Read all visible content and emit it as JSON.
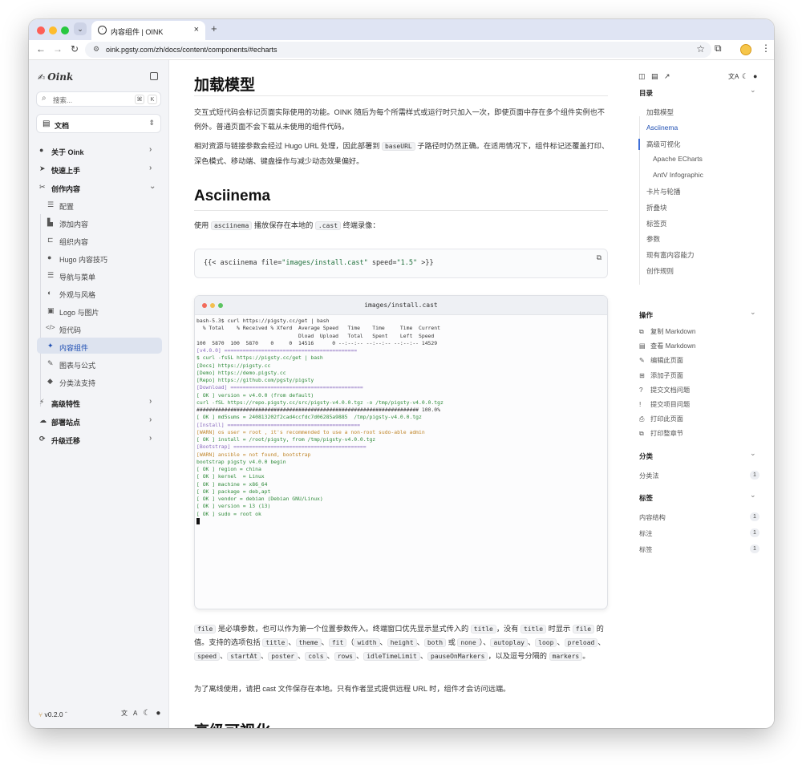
{
  "browser": {
    "tab_title": "内容组件 | OINK",
    "tab_close": "×",
    "new_tab": "+",
    "url": "oink.pgsty.com/zh/docs/content/components/#echarts",
    "nav": {
      "back": "←",
      "forward": "→",
      "reload": "↻"
    }
  },
  "sidebar": {
    "logo_text": "Oink",
    "search_placeholder": "搜索...",
    "search_kbd": [
      "⌘",
      "K"
    ],
    "doc_selector": "文档",
    "items": [
      {
        "label": "关于 Oink",
        "icon": "●"
      },
      {
        "label": "快速上手",
        "icon": "➤"
      },
      {
        "label": "创作内容",
        "icon": "✂"
      }
    ],
    "sub_items": [
      {
        "label": "配置",
        "icon": "☰"
      },
      {
        "label": "添加内容",
        "icon": "▙"
      },
      {
        "label": "组织内容",
        "icon": "⊏"
      },
      {
        "label": "Hugo 内容技巧",
        "icon": "●"
      },
      {
        "label": "导航与菜单",
        "icon": "☰"
      },
      {
        "label": "外观与风格",
        "icon": "◐"
      },
      {
        "label": "Logo 与图片",
        "icon": "▣"
      },
      {
        "label": "短代码",
        "icon": "</>"
      },
      {
        "label": "内容组件",
        "icon": "✦"
      },
      {
        "label": "图表与公式",
        "icon": "✎"
      },
      {
        "label": "分类法支持",
        "icon": "◆"
      }
    ],
    "bottom_items": [
      {
        "label": "高级特性",
        "icon": "⚡"
      },
      {
        "label": "部署站点",
        "icon": "☁"
      },
      {
        "label": "升级迁移",
        "icon": "⟳"
      }
    ],
    "version": "v0.2.0",
    "footer_icons": [
      "translate-icon",
      "moon-icon",
      "github-icon"
    ]
  },
  "main": {
    "h1": "加载模型",
    "p1": "交互式短代码会标记页面实际使用的功能。OINK 随后为每个所需样式或运行时只加入一次，即使页面中存在多个组件实例也不例外。普通页面不会下载从未使用的组件代码。",
    "p2_a": "相对资源与链接参数会经过 Hugo URL 处理，因此部署到",
    "p2_code": "baseURL",
    "p2_b": "子路径时仍然正确。在适用情况下，组件标记还覆盖打印、深色模式、移动端、键盘操作与减少动态效果偏好。",
    "h2": "Asciinema",
    "p3_a": "使用",
    "p3_code1": "asciinema",
    "p3_b": "播放保存在本地的",
    "p3_code2": ".cast",
    "p3_c": "终端录像：",
    "code_pre": "{{< asciinema file=",
    "code_str1": "\"images/install.cast\"",
    "code_mid": " speed=",
    "code_str2": "\"1.5\"",
    "code_post": " >}}",
    "term_title": "images/install.cast",
    "p4_file": "file",
    "p4_a": "是必填参数，也可以作为第一个位置参数传入。终端窗口优先显示显式传入的",
    "p4_title1": "title",
    "p4_b": "，没有",
    "p4_title2": "title",
    "p4_c": "时显示",
    "p4_file2": "file",
    "p4_d": "的值。支持的选项包括",
    "opts1": [
      "title",
      "theme",
      "fit"
    ],
    "opts_paren": [
      "width",
      "height",
      "both"
    ],
    "opts_or": "或",
    "opt_none": "none",
    "opts2": [
      "autoplay",
      "loop",
      "preload",
      "speed",
      "startAt",
      "poster",
      "cols",
      "rows",
      "idleTimeLimit",
      "pauseOnMarkers"
    ],
    "p4_e": "，以及逗号分隔的",
    "p4_markers": "markers",
    "p4_f": "。",
    "p5": "为了离线使用，请把 cast 文件保存在本地。只有作者显式提供远程 URL 时，组件才会访问远端。",
    "h2b": "高级可视化"
  },
  "terminal_lines": [
    {
      "t": "bash-5.3$ curl https://pigsty.cc/get | bash",
      "c": "#333"
    },
    {
      "t": "  % Total    % Received % Xferd  Average Speed   Time    Time     Time  Current",
      "c": "#333"
    },
    {
      "t": "                                 Dload  Upload   Total   Spent    Left  Speed",
      "c": "#333"
    },
    {
      "t": "100  5870  100  5870    0     0  14516      0 --:--:-- --:--:-- --:--:-- 14529",
      "c": "#333"
    },
    {
      "t": "[v4.0.0] ===========================================",
      "c": "#8a6bbf"
    },
    {
      "t": "$ curl -fsSL https://pigsty.cc/get | bash",
      "c": "#2f8a3a"
    },
    {
      "t": "[Docs] https://pigsty.cc",
      "c": "#2f8a3a"
    },
    {
      "t": "[Demo] https://demo.pigsty.cc",
      "c": "#2f8a3a"
    },
    {
      "t": "[Repo] https://github.com/pgsty/pigsty",
      "c": "#2f8a3a"
    },
    {
      "t": "[Download] ===========================================",
      "c": "#8a6bbf"
    },
    {
      "t": "[ OK ] version = v4.0.0 (from default)",
      "c": "#2f8a3a"
    },
    {
      "t": "curl -fSL https://repo.pigsty.cc/src/pigsty-v4.0.0.tgz -o /tmp/pigsty-v4.0.0.tgz",
      "c": "#2f8a3a"
    },
    {
      "t": "######################################################################## 100.0%",
      "c": "#333"
    },
    {
      "t": "[ OK ] md5sums = 240813202f2cad4ccfdc7d06285a9885  /tmp/pigsty-v4.0.0.tgz",
      "c": "#2f8a3a"
    },
    {
      "t": "[Install] ===========================================",
      "c": "#8a6bbf"
    },
    {
      "t": "[WARN] os user = root , it's recommended to use a non-root sudo-able admin",
      "c": "#c0862a"
    },
    {
      "t": "[ OK ] install = /root/pigsty, from /tmp/pigsty-v4.0.0.tgz",
      "c": "#2f8a3a"
    },
    {
      "t": "[Bootstrap] ===========================================",
      "c": "#8a6bbf"
    },
    {
      "t": "[WARN] ansible = not found, bootstrap",
      "c": "#c0862a"
    },
    {
      "t": "bootstrap pigsty v4.0.0 begin",
      "c": "#2f8a3a"
    },
    {
      "t": "[ OK ] region = china",
      "c": "#2f8a3a"
    },
    {
      "t": "[ OK ] kernel  = Linux",
      "c": "#2f8a3a"
    },
    {
      "t": "[ OK ] machine = x86_64",
      "c": "#2f8a3a"
    },
    {
      "t": "[ OK ] package = deb,apt",
      "c": "#2f8a3a"
    },
    {
      "t": "[ OK ] vendor = debian (Debian GNU/Linux)",
      "c": "#2f8a3a"
    },
    {
      "t": "[ OK ] version = 13 (13)",
      "c": "#2f8a3a"
    },
    {
      "t": "[ OK ] sudo = root ok",
      "c": "#2f8a3a"
    }
  ],
  "toc": {
    "heading": "目录",
    "items": [
      {
        "label": "加载模型",
        "indent": 0
      },
      {
        "label": "Asciinema",
        "indent": 0,
        "active": true
      },
      {
        "label": "高级可视化",
        "indent": 0
      },
      {
        "label": "Apache ECharts",
        "indent": 1
      },
      {
        "label": "AntV Infographic",
        "indent": 1
      },
      {
        "label": "卡片与轮播",
        "indent": 0
      },
      {
        "label": "折叠块",
        "indent": 0
      },
      {
        "label": "标签页",
        "indent": 0
      },
      {
        "label": "参数",
        "indent": 0
      },
      {
        "label": "现有富内容能力",
        "indent": 0
      },
      {
        "label": "创作规则",
        "indent": 0
      }
    ],
    "actions_heading": "操作",
    "actions": [
      {
        "label": "复制 Markdown",
        "icon": "⧉"
      },
      {
        "label": "查看 Markdown",
        "icon": "▤"
      },
      {
        "label": "编辑此页面",
        "icon": "✎"
      },
      {
        "label": "添加子页面",
        "icon": "⊞"
      },
      {
        "label": "提交文档问题",
        "icon": "?"
      },
      {
        "label": "提交项目问题",
        "icon": "!"
      },
      {
        "label": "打印此页面",
        "icon": "⎙"
      },
      {
        "label": "打印整章节",
        "icon": "⧉"
      }
    ],
    "taxonomy_heading": "分类",
    "taxonomy": [
      {
        "label": "分类法",
        "count": "1"
      }
    ],
    "tags_heading": "标签",
    "tags": [
      {
        "label": "内容结构",
        "count": "1"
      },
      {
        "label": "标注",
        "count": "1"
      },
      {
        "label": "标签",
        "count": "1"
      }
    ]
  }
}
